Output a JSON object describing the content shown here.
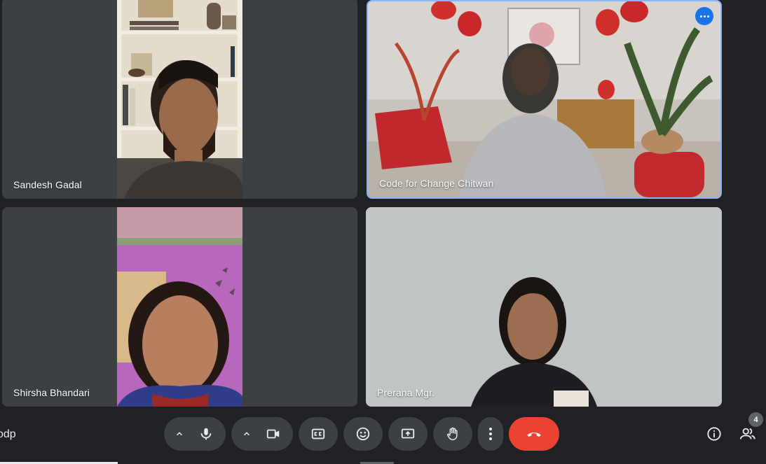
{
  "participants": [
    {
      "id": "sandesh",
      "name": "Sandesh Gadal"
    },
    {
      "id": "code",
      "name": "Code for Change Chitwan"
    },
    {
      "id": "shirsha",
      "name": "Shirsha Bhandari"
    },
    {
      "id": "prerana",
      "name": "Prerana Mgr."
    }
  ],
  "meeting": {
    "code_fragment": "odp"
  },
  "people_count": "4",
  "icons": [
    "more-options-icon",
    "chevron-up-icon",
    "microphone-icon",
    "camera-icon",
    "captions-icon",
    "emoji-icon",
    "present-screen-icon",
    "raise-hand-icon",
    "more-vert-icon",
    "end-call-icon",
    "info-icon",
    "people-icon"
  ],
  "colors": {
    "end_call": "#ea4335",
    "active_speaker_border": "#8ab4f8",
    "more_button": "#1a73e8",
    "control_bg": "#3c4043"
  }
}
